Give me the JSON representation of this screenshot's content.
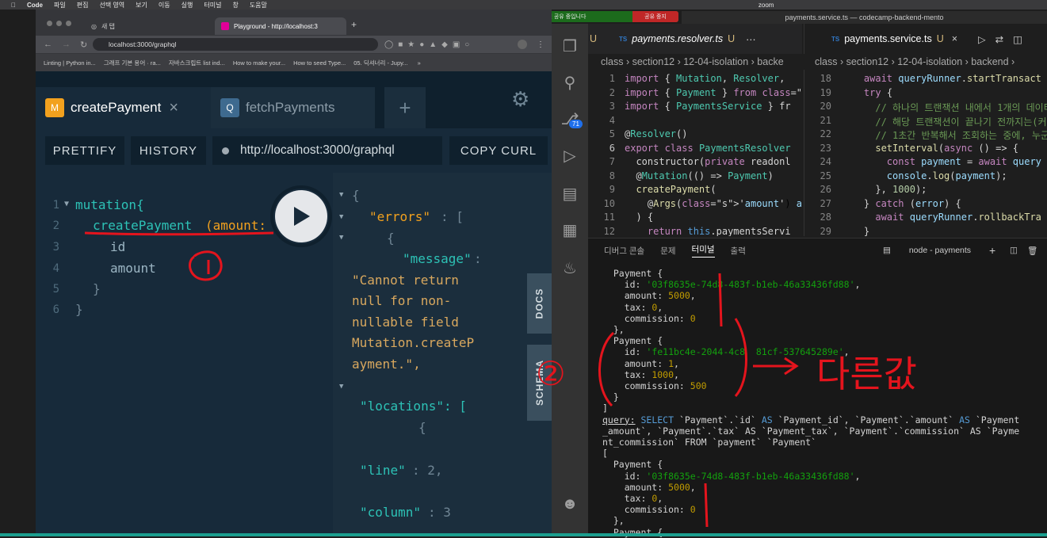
{
  "menubar": {
    "app": "Code",
    "items": [
      "파일",
      "편집",
      "선택 영역",
      "보기",
      "이동",
      "실행",
      "터미널",
      "창",
      "도움말"
    ],
    "zoom": "zoom"
  },
  "share": {
    "text": "화면 공유 중입니다",
    "stop": "공유 중지"
  },
  "window_title": "payments.service.ts — codecamp-backend-mento",
  "browser": {
    "tabs": [
      "새 탭",
      "Playground - http://localhost:3"
    ],
    "url": "localhost:3000/graphql",
    "bookmarks": [
      "Linting | Python in...",
      "그래프 기본 용어 · ra...",
      "자바스크립트 list ind...",
      "How to make your...",
      "How to seed Type...",
      "05. 딕셔너리 - Jupy..."
    ]
  },
  "playground": {
    "tabs": [
      {
        "badge": "M",
        "label": "createPayment",
        "close": "×"
      },
      {
        "badge": "Q",
        "label": "fetchPayments"
      }
    ],
    "add": "+",
    "toolbar": {
      "prettify": "PRETTIFY",
      "history": "HISTORY",
      "endpoint": "http://localhost:3000/graphql",
      "copy": "COPY CURL"
    },
    "line_numbers": [
      "1",
      "2",
      "3",
      "4",
      "5",
      "6"
    ],
    "code": {
      "l1": "mutation{",
      "l2a": "createPayment",
      "l2b": "(amount:",
      "l3": "id",
      "l4": "amount",
      "l5": "}",
      "l6": "}"
    },
    "result": {
      "l1": "{",
      "l2a": "\"errors\"",
      "l2b": ": [",
      "l3": "{",
      "l4a": "\"message\"",
      "l4b": ":",
      "l5": "\"Cannot return",
      "l6": "null for non-",
      "l7": "nullable field",
      "l8": "Mutation.createP",
      "l9": "ayment.\",",
      "l10": "\"locations\": [",
      "l11": "{",
      "l12a": "\"line\"",
      "l12b": ": 2,",
      "l13a": "\"column\"",
      "l13b": ": 3"
    },
    "side": {
      "docs": "DOCS",
      "schema": "SCHEMA"
    }
  },
  "vscode": {
    "left_tabs": {
      "u": "U",
      "file": "payments.resolver.ts",
      "mark": "U"
    },
    "right_tabs": {
      "file": "payments.service.ts",
      "mark": "U"
    },
    "left_crumb": "class › section12 › 12-04-isolation › backe",
    "right_crumb": "class › section12 › 12-04-isolation › backend ›",
    "scm_badge": "71",
    "left_lines": [
      "1",
      "2",
      "3",
      "4",
      "5",
      "6",
      "7",
      "8",
      "9",
      "10",
      "11",
      "12"
    ],
    "left_code": [
      "import { Mutation, Resolver, ",
      "import { Payment } from './en",
      "import { PaymentsService } fr",
      "",
      "@Resolver()",
      "export class PaymentsResolver",
      "  constructor(private readonl",
      "  @Mutation(() => Payment)",
      "  createPayment(",
      "    @Args('amount') amount: n",
      "  ) {",
      "    return this.paymentsServi"
    ],
    "right_lines": [
      "18",
      "19",
      "20",
      "21",
      "22",
      "23",
      "24",
      "25",
      "26",
      "27",
      "28",
      "29"
    ],
    "right_code": [
      "    await queryRunner.startTransact",
      "    try {",
      "      // 하나의 트랜잭션 내에서 1개의 데이터",
      "      // 해당 트랜잭션이 끝나기 전까지는(커",
      "      // 1초간 반복해서 조회하는 중에, 누군",
      "      setInterval(async () => {",
      "        const payment = await query",
      "        console.log(payment);",
      "      }, 1000);",
      "    } catch (error) {",
      "      await queryRunner.rollbackTra",
      "    }"
    ],
    "panel_tabs": [
      "디버그 콘솔",
      "문제",
      "터미널",
      "출력"
    ],
    "terminal_name": "node - payments",
    "terminal": [
      "  Payment {",
      "    id: '03f8635e-74d8-483f-b1eb-46a33436fd88',",
      "    amount: 5000,",
      "    tax: 0,",
      "    commission: 0",
      "  },",
      "  Payment {",
      "    id: 'fe11bc4e-2044-4c8  81cf-537645289e',",
      "    amount: 1,",
      "    tax: 1000,",
      "    commission: 500",
      "  }",
      "]",
      "query: SELECT `Payment`.`id` AS `Payment_id`, `Payment`.`amount` AS `Payment",
      "_amount`, `Payment`.`tax` AS `Payment_tax`, `Payment`.`commission` AS `Payme",
      "nt_commission` FROM `payment` `Payment`",
      "[",
      "  Payment {",
      "    id: '03f8635e-74d8-483f-b1eb-46a33436fd88',",
      "    amount: 5000,",
      "    tax: 0,",
      "    commission: 0",
      "  },",
      "  Payment {"
    ]
  },
  "annotations": {
    "one": "1",
    "two": "2",
    "different": "다른값"
  }
}
